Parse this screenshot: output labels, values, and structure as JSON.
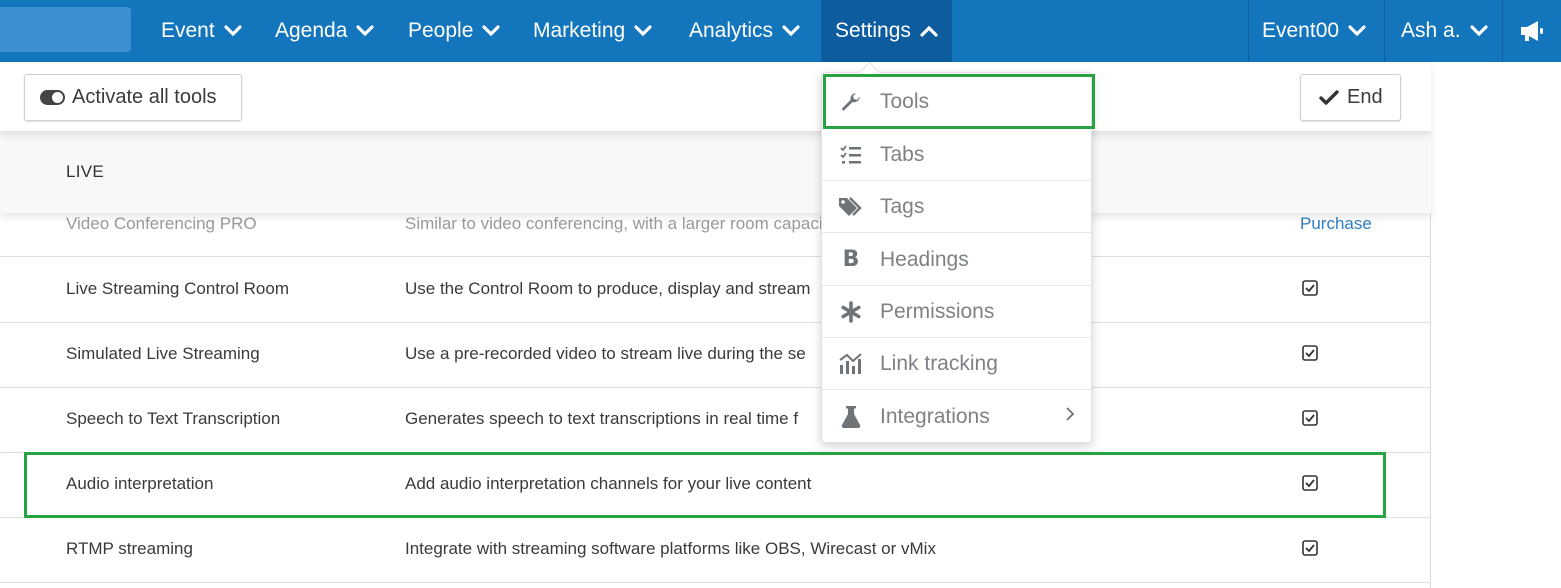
{
  "nav": {
    "items": [
      {
        "label": "Event"
      },
      {
        "label": "Agenda"
      },
      {
        "label": "People"
      },
      {
        "label": "Marketing"
      },
      {
        "label": "Analytics"
      },
      {
        "label": "Settings"
      }
    ],
    "event_selector": "Event00",
    "user": "Ash a.",
    "announce_icon": "megaphone-icon"
  },
  "toolbar": {
    "activate_label": "Activate all tools",
    "end_label": "End"
  },
  "section": {
    "title": "LIVE"
  },
  "rows": [
    {
      "name": "Video Conferencing PRO",
      "desc": "Similar to video conferencing, with a larger room capacity",
      "action": "Purchase"
    },
    {
      "name": "Live Streaming Control Room",
      "desc": "Use the Control Room to produce, display and stream",
      "checked": true
    },
    {
      "name": "Simulated Live Streaming",
      "desc": "Use a pre-recorded video to stream live during the se",
      "checked": true
    },
    {
      "name": "Speech to Text Transcription",
      "desc": "Generates speech to text transcriptions in real time f",
      "checked": true
    },
    {
      "name": "Audio interpretation",
      "desc": "Add audio interpretation channels for your live content",
      "checked": true
    },
    {
      "name": "RTMP streaming",
      "desc": "Integrate with streaming software platforms like OBS, Wirecast or vMix",
      "checked": true
    }
  ],
  "dropdown": {
    "items": [
      {
        "label": "Tools",
        "icon": "wrench-icon"
      },
      {
        "label": "Tabs",
        "icon": "checklist-icon"
      },
      {
        "label": "Tags",
        "icon": "tags-icon"
      },
      {
        "label": "Headings",
        "icon": "bold-icon"
      },
      {
        "label": "Permissions",
        "icon": "asterisk-icon"
      },
      {
        "label": "Link tracking",
        "icon": "chart-icon"
      },
      {
        "label": "Integrations",
        "icon": "flask-icon"
      }
    ]
  },
  "colors": {
    "nav_bg": "#1375bc",
    "nav_active": "#0d5d9e",
    "highlight": "#27a343",
    "link": "#2f7fc4"
  }
}
